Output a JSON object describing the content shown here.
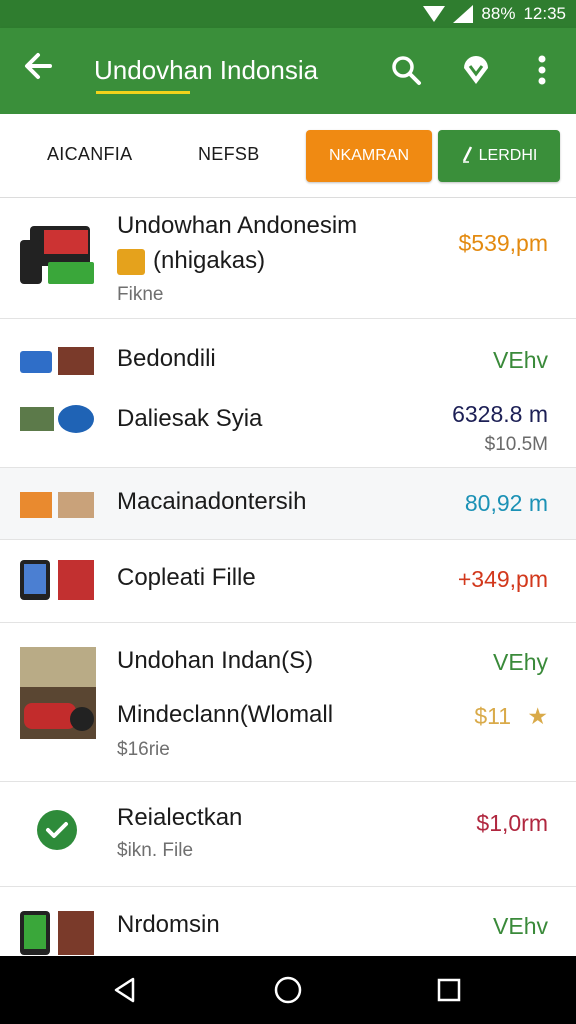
{
  "status_bar": {
    "battery_text": "88%",
    "time": "12:35"
  },
  "app_bar": {
    "title": "Undovhan Indonsia",
    "icons": [
      "back-arrow-icon",
      "search-icon",
      "map-pin-icon",
      "more-vert-icon"
    ]
  },
  "tabs": {
    "tab1": "AICANFIA",
    "tab2": "NEFSB",
    "button_orange": "NKAMRAN",
    "button_green": "LERDHI"
  },
  "list": [
    {
      "title": "Undowhan Andonesim",
      "subtitle": "(nhigakas)",
      "meta": "Fikne",
      "price": "$539,pm"
    },
    {
      "title": "Bedondili",
      "price": "VEhv"
    },
    {
      "title": "Daliesak Syia",
      "price": "6328.8 m",
      "price_sub": "$10.5M"
    },
    {
      "title": "Macainadontersih",
      "price": "80,92 m"
    },
    {
      "title": "Copleati Fille",
      "price": "+349,pm"
    },
    {
      "title": "Undohan Indan(S)",
      "price": "VEhy"
    },
    {
      "title": "Mindeclann(Wlomall",
      "meta": "$16rie",
      "price": "$11"
    },
    {
      "title": "Reialectkan",
      "meta": "$ikn. File",
      "price": "$1,0rm"
    },
    {
      "title": "Nrdomsin",
      "price": "VEhv"
    }
  ],
  "colors": {
    "app_bar": "#3a8f3a",
    "status_bar": "#2f7d2f",
    "accent_orange": "#f08a12",
    "accent_green": "#3a8f3a"
  }
}
